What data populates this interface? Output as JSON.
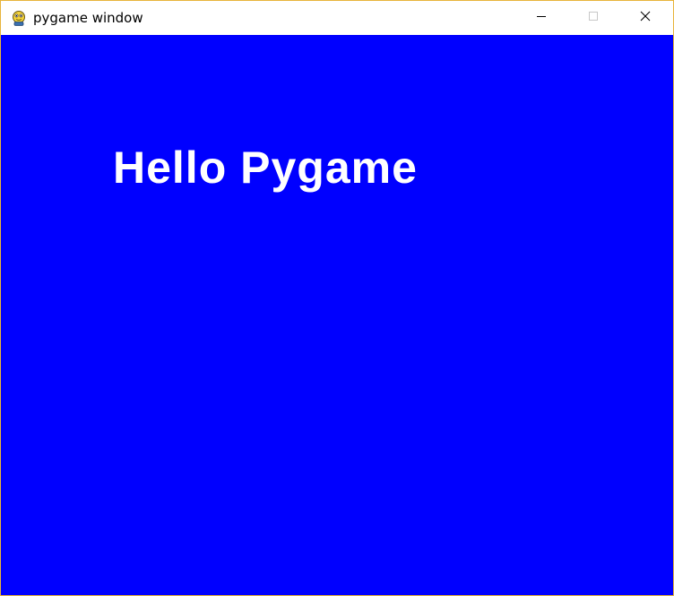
{
  "window": {
    "title": "pygame window",
    "app_icon": "pygame-snake-icon",
    "frame_color": "#e8b53c",
    "controls": {
      "minimize_icon": "minimize-icon",
      "maximize_icon": "maximize-icon",
      "close_icon": "close-icon"
    }
  },
  "canvas": {
    "background_color": "#0000ff",
    "text_color": "#ffffff",
    "text": "Hello Pygame"
  }
}
